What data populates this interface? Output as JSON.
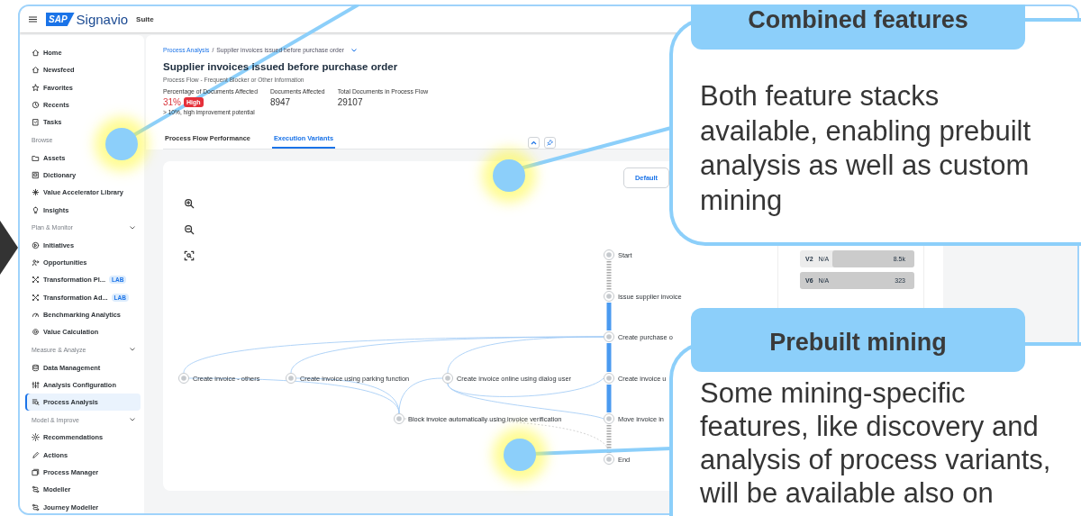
{
  "app": {
    "logo": "SAP",
    "product": "Signavio",
    "edition": "Suite"
  },
  "sidebar": {
    "sections": [
      {
        "items": [
          {
            "label": "Home",
            "selected": false
          },
          {
            "label": "Newsfeed",
            "selected": false
          },
          {
            "label": "Favorites",
            "selected": false
          },
          {
            "label": "Recents",
            "selected": false
          },
          {
            "label": "Tasks",
            "selected": false
          }
        ]
      },
      {
        "heading": "Browse",
        "items": [
          {
            "label": "Assets",
            "selected": false
          },
          {
            "label": "Dictionary",
            "selected": false
          },
          {
            "label": "Value Accelerator Library",
            "selected": false
          },
          {
            "label": "Insights",
            "selected": false
          }
        ]
      },
      {
        "heading": "Plan & Monitor",
        "expanded": true,
        "items": [
          {
            "label": "Initiatives",
            "selected": false
          },
          {
            "label": "Opportunities",
            "selected": false
          },
          {
            "label": "Transformation Pl...",
            "badge": "LAB",
            "selected": false
          },
          {
            "label": "Transformation Ad...",
            "badge": "LAB",
            "selected": false
          },
          {
            "label": "Benchmarking Analytics",
            "selected": false
          },
          {
            "label": "Value Calculation",
            "selected": false
          }
        ]
      },
      {
        "heading": "Measure & Analyze",
        "expanded": true,
        "items": [
          {
            "label": "Data Management",
            "selected": false
          },
          {
            "label": "Analysis Configuration",
            "selected": false
          },
          {
            "label": "Process Analysis",
            "selected": true
          }
        ]
      },
      {
        "heading": "Model & Improve",
        "expanded": true,
        "items": [
          {
            "label": "Recommendations",
            "selected": false
          },
          {
            "label": "Actions",
            "selected": false
          },
          {
            "label": "Process Manager",
            "selected": false
          },
          {
            "label": "Modeller",
            "selected": false
          },
          {
            "label": "Journey Modeller",
            "selected": false
          }
        ]
      }
    ]
  },
  "header": {
    "breadcrumb": [
      {
        "label": "Process Analysis",
        "kind": "link"
      },
      {
        "label": "/",
        "kind": "separator"
      },
      {
        "label": "Supplier invoices issued before purchase order",
        "kind": "current"
      }
    ],
    "title": "Supplier invoices issued before purchase order",
    "subtitle": "Process Flow - Frequent Blocker or Other Information",
    "metrics": [
      {
        "label": "Percentage of Documents Affected",
        "value": "31%",
        "badge": "High",
        "note": "> 10%, high improvement potential",
        "kind": "alert"
      },
      {
        "label": "Documents Affected",
        "value": "8947",
        "kind": "plain"
      },
      {
        "label": "Total Documents in Process Flow",
        "value": "29107",
        "kind": "plain"
      }
    ]
  },
  "tabs": [
    {
      "label": "Process Flow Performance",
      "selected": false
    },
    {
      "label": "Execution Variants",
      "selected": true
    }
  ],
  "canvas": {
    "view_button": "Default",
    "nodes": [
      {
        "label": "Start"
      },
      {
        "label": "Issue supplier invoice"
      },
      {
        "label": "Create purchase o"
      },
      {
        "label": "Create invoice u"
      },
      {
        "label": "Move invoice in"
      },
      {
        "label": "End"
      },
      {
        "label": "Create invoice - others"
      },
      {
        "label": "Create invoice using parking function"
      },
      {
        "label": "Create invoice online using dialog user"
      },
      {
        "label": "Block invoice automatically using invoice verification"
      }
    ],
    "variants": [
      {
        "id": "V2",
        "status": "N/A",
        "count": "8.5k",
        "level": 0.72
      },
      {
        "id": "V6",
        "status": "N/A",
        "count": "323",
        "level": 1
      }
    ]
  },
  "callouts": [
    {
      "title": "Combined features",
      "body": "Both feature stacks available, enabling prebuilt analysis as well as custom mining"
    },
    {
      "title": "Prebuilt mining",
      "body": "Some mining-specific features, like discovery and analysis of process variants, will be available also on"
    }
  ]
}
